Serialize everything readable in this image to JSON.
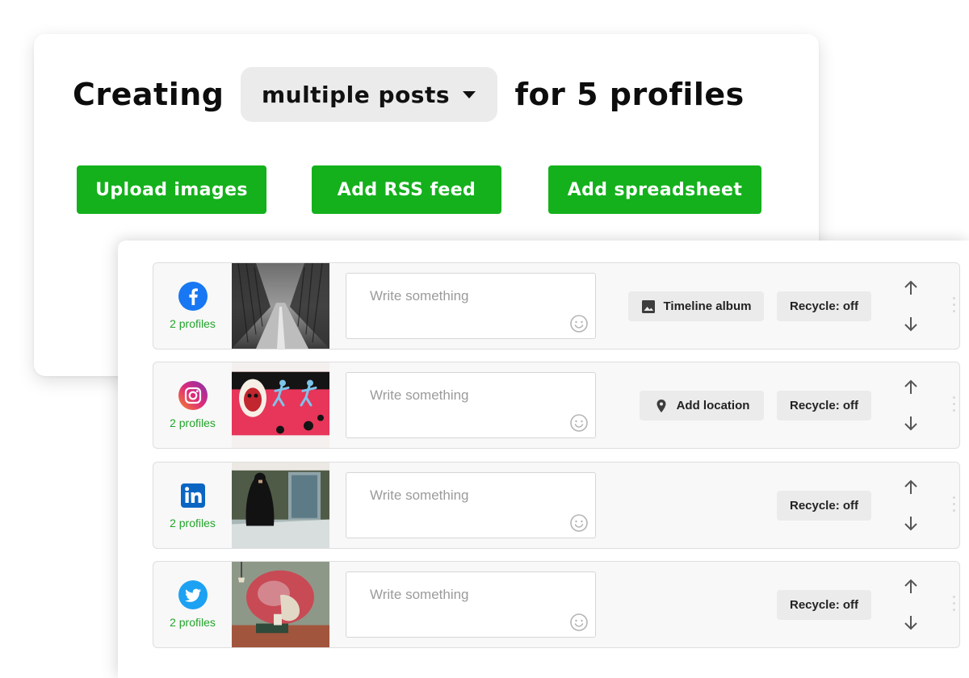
{
  "header": {
    "prefix": "Creating",
    "mode_selected": "multiple posts",
    "suffix": "for 5 profiles"
  },
  "actions": {
    "upload_images": "Upload images",
    "add_rss_feed": "Add RSS feed",
    "add_spreadsheet": "Add spreadsheet"
  },
  "posts": [
    {
      "network": "facebook",
      "icon": "facebook-icon",
      "color": "#1877f2",
      "profiles_label": "2 profiles",
      "placeholder": "Write something",
      "extra_chip": "Timeline album",
      "extra_icon": "image-icon",
      "recycle": "Recycle: off"
    },
    {
      "network": "instagram",
      "icon": "instagram-icon",
      "color": "#e1306c",
      "profiles_label": "2 profiles",
      "placeholder": "Write something",
      "extra_chip": "Add location",
      "extra_icon": "location-pin-icon",
      "recycle": "Recycle: off"
    },
    {
      "network": "linkedin",
      "icon": "linkedin-icon",
      "color": "#0a66c2",
      "profiles_label": "2 profiles",
      "placeholder": "Write something",
      "recycle": "Recycle: off"
    },
    {
      "network": "twitter",
      "icon": "twitter-icon",
      "color": "#1da1f2",
      "profiles_label": "2 profiles",
      "placeholder": "Write something",
      "recycle": "Recycle: off"
    }
  ],
  "colors": {
    "accent_green": "#14b11c",
    "profiles_green": "#22a52a",
    "chip_gray": "#ebebeb"
  }
}
